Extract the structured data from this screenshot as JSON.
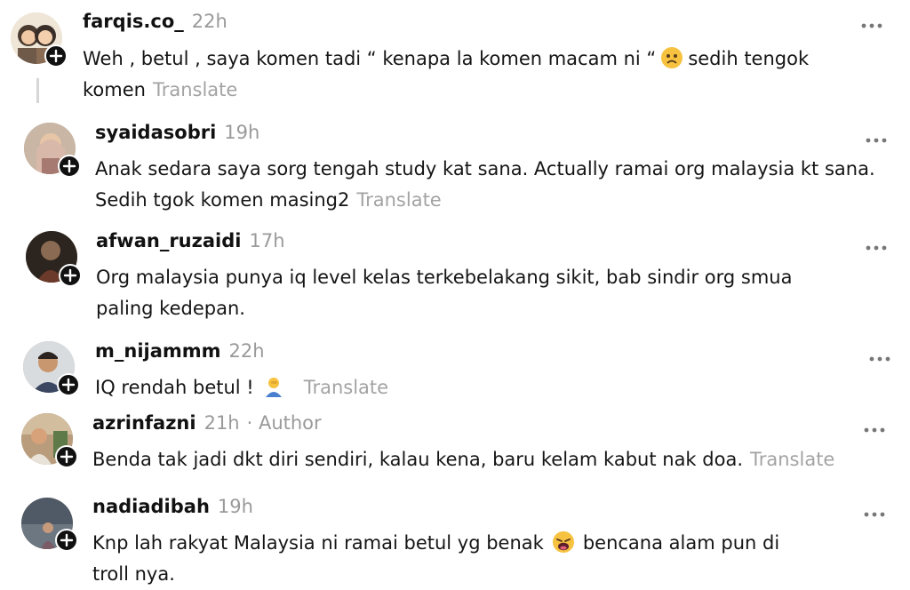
{
  "colors": {
    "text": "#101010",
    "muted": "#9a9a9a",
    "translate": "#a3a3a3"
  },
  "icons": {
    "more": "more-icon",
    "follow": "plus-icon"
  },
  "comments": [
    {
      "username": "farqis.co_",
      "time": "22h",
      "text_a": "Weh , betul , saya komen tadi “ kenapa la komen macam ni “",
      "text_b": "sedih tengok",
      "text_c": "komen",
      "emoji": "worried-face",
      "translate": "Translate"
    },
    {
      "username": "syaidasobri",
      "time": "19h",
      "text_a": "Anak sedara saya sorg tengah study kat sana. Actually ramai org malaysia kt sana.",
      "text_b": "Sedih tgok komen masing2",
      "translate": "Translate"
    },
    {
      "username": "afwan_ruzaidi",
      "time": "17h",
      "text_a": "Org malaysia punya iq level kelas terkebelakang sikit, bab sindir org smua",
      "text_b": "paling kedepan."
    },
    {
      "username": "m_nijammm",
      "time": "22h",
      "text_a": "IQ rendah betul !",
      "emoji": "person-facepalming",
      "translate": "Translate"
    },
    {
      "username": "azrinfazni",
      "time": "21h",
      "author": "· Author",
      "text_a": "Benda tak jadi dkt diri sendiri, kalau kena, baru kelam kabut nak doa.",
      "translate": "Translate"
    },
    {
      "username": "nadiadibah",
      "time": "19h",
      "text_a": "Knp lah rakyat Malaysia ni ramai betul yg benak",
      "text_b": "bencana alam pun di",
      "text_c": "troll nya.",
      "emoji": "weary-face"
    }
  ]
}
